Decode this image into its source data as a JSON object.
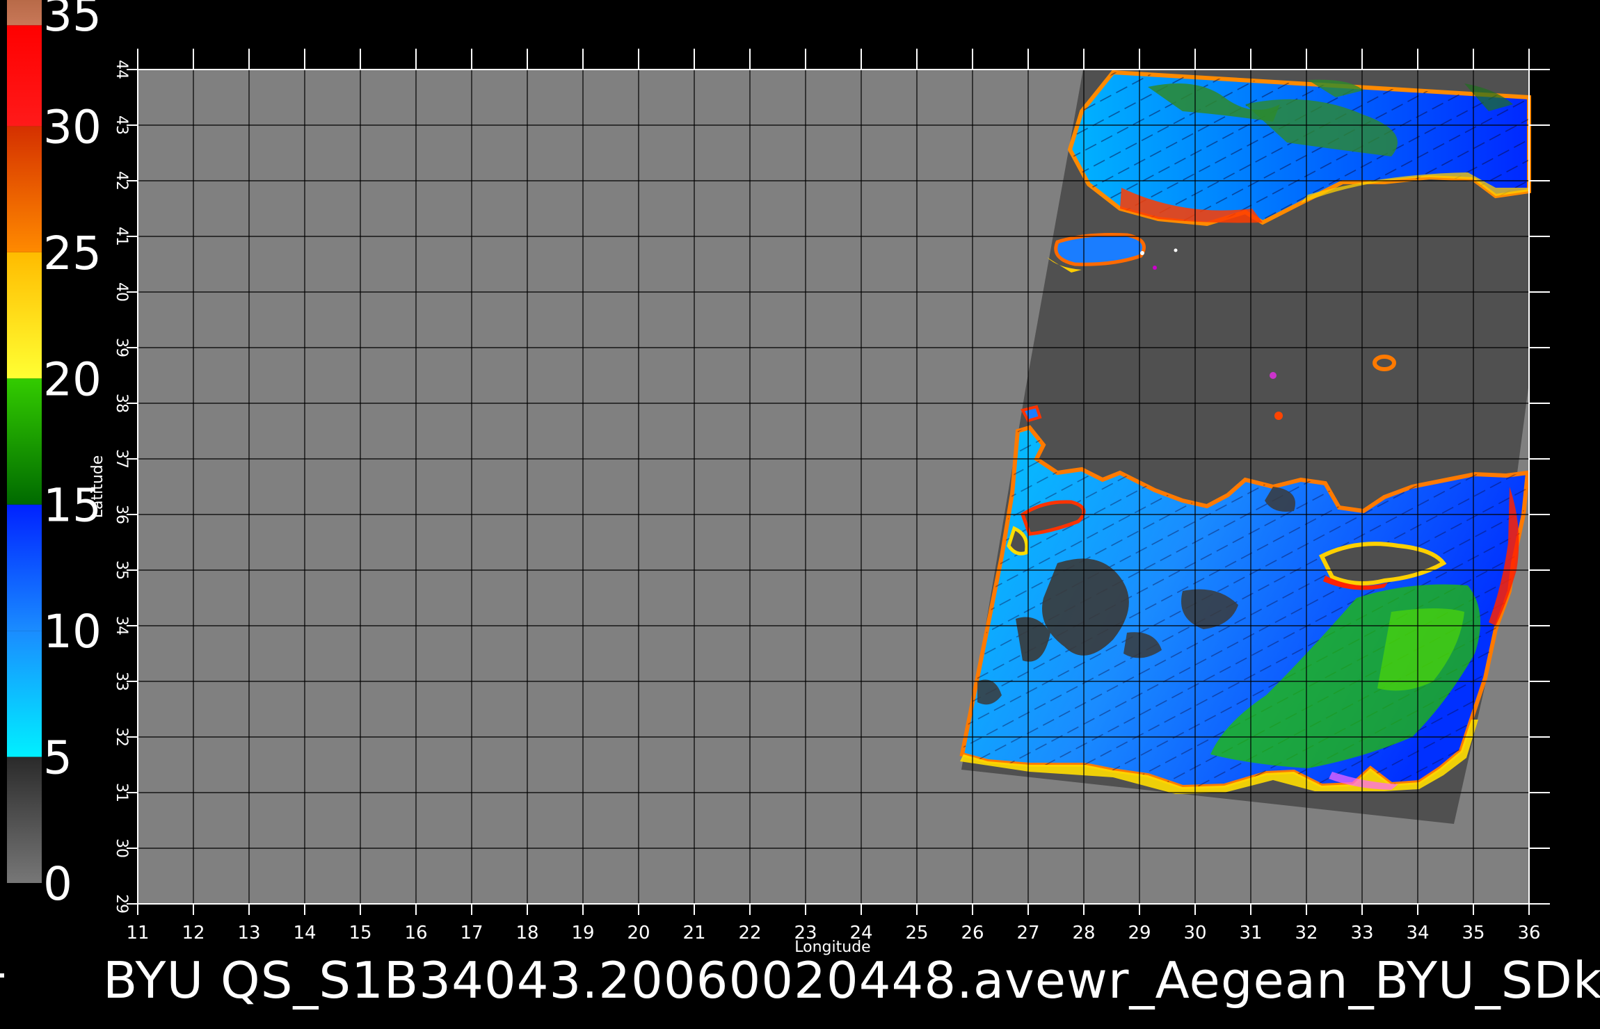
{
  "map": {
    "x_axis_label": "Longitude",
    "y_axis_label": "Latitude",
    "lon_ticks": [
      "11",
      "12",
      "13",
      "14",
      "15",
      "16",
      "17",
      "18",
      "19",
      "20",
      "21",
      "22",
      "23",
      "24",
      "25",
      "26",
      "27",
      "28",
      "29",
      "30",
      "31",
      "32",
      "33",
      "34",
      "35",
      "36"
    ],
    "lat_ticks": [
      "29",
      "30",
      "31",
      "32",
      "33",
      "34",
      "35",
      "36",
      "37",
      "38",
      "39",
      "40",
      "41",
      "42",
      "43",
      "44"
    ],
    "lon_range": [
      11,
      36
    ],
    "lat_range": [
      29,
      44
    ]
  },
  "colorbar": {
    "labels": [
      "0",
      "5",
      "10",
      "15",
      "20",
      "25",
      "30",
      "35"
    ],
    "bands": [
      {
        "from": 0,
        "to": 5,
        "colors": [
          "#777777",
          "#2a2a2a"
        ]
      },
      {
        "from": 5,
        "to": 10,
        "colors": [
          "#00f0ff",
          "#1a8cff"
        ]
      },
      {
        "from": 10,
        "to": 15,
        "colors": [
          "#1a8cff",
          "#0022ff"
        ]
      },
      {
        "from": 15,
        "to": 20,
        "colors": [
          "#006a00",
          "#33cc00"
        ]
      },
      {
        "from": 20,
        "to": 25,
        "colors": [
          "#ffff33",
          "#ffbb00"
        ]
      },
      {
        "from": 25,
        "to": 30,
        "colors": [
          "#ff8a00",
          "#d43000"
        ]
      },
      {
        "from": 30,
        "to": 34,
        "colors": [
          "#ff1a1a",
          "#ff0000"
        ]
      },
      {
        "from": 34,
        "to": 35,
        "colors": [
          "#c87858",
          "#b86a48"
        ]
      }
    ]
  },
  "colors": {
    "map_background": "#808080",
    "swath_nodata": "#4e4e4e",
    "land": "#4e4e4e",
    "grid": "#000000"
  },
  "caption": "BYU  QS_S1B34043.20060020448.avewr_Aegean_BYU_SDk"
}
